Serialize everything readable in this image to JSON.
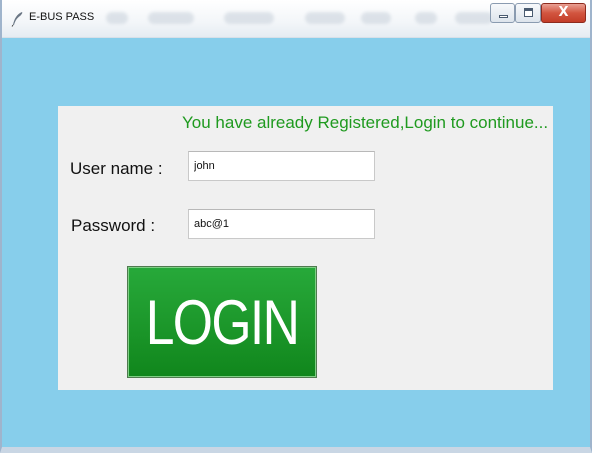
{
  "window": {
    "title": "E-BUS PASS",
    "icon": "feather-icon",
    "controls": {
      "minimize": "minimize-icon",
      "maximize": "maximize-icon",
      "close": "X"
    }
  },
  "form": {
    "message": "You have already Registered,Login to continue...",
    "username_label": "User name :",
    "username_value": "john",
    "password_label": "Password :",
    "password_value": "abc@1",
    "login_label": "LOGIN"
  },
  "colors": {
    "window_bg": "#87ceeb",
    "panel_bg": "#f0f0f0",
    "message_text": "#1f9a1f",
    "login_button": "#1e9a2d"
  }
}
